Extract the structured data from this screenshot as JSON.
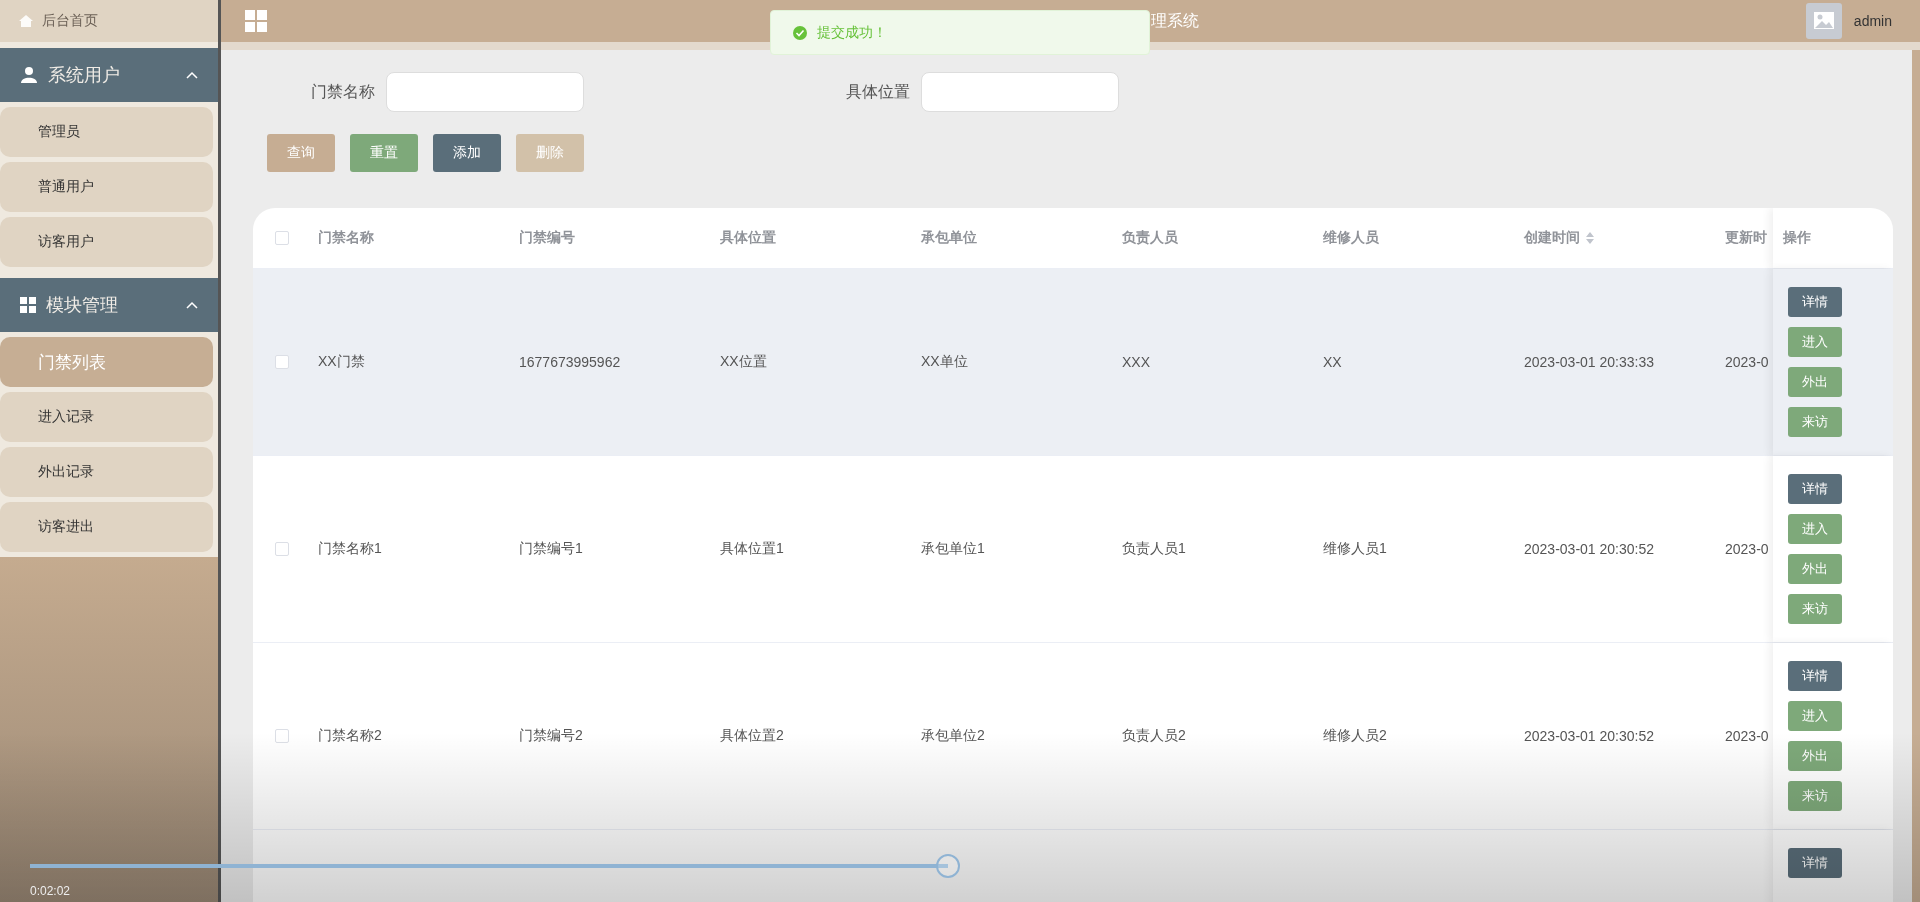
{
  "top_bar": {
    "title": "理系统",
    "user": "admin"
  },
  "toast": {
    "kind": "success",
    "message": "提交成功！"
  },
  "sidebar": {
    "home": "后台首页",
    "groups": [
      {
        "label": "系统用户",
        "expanded": true,
        "items": [
          {
            "label": "管理员",
            "selected": false
          },
          {
            "label": "普通用户",
            "selected": false
          },
          {
            "label": "访客用户",
            "selected": false
          }
        ]
      },
      {
        "label": "模块管理",
        "expanded": true,
        "items": [
          {
            "label": "门禁列表",
            "selected": true
          },
          {
            "label": "进入记录",
            "selected": false
          },
          {
            "label": "外出记录",
            "selected": false
          },
          {
            "label": "访客进出",
            "selected": false
          }
        ]
      }
    ]
  },
  "search": {
    "fields": [
      {
        "label": "门禁名称"
      },
      {
        "label": "具体位置"
      }
    ],
    "buttons": [
      {
        "label": "查询",
        "kind": "query",
        "disabled": false
      },
      {
        "label": "重置",
        "kind": "reset",
        "disabled": false
      },
      {
        "label": "添加",
        "kind": "add",
        "disabled": false
      },
      {
        "label": "删除",
        "kind": "delete",
        "disabled": true
      }
    ]
  },
  "table": {
    "columns": [
      {
        "label": "门禁名称"
      },
      {
        "label": "门禁编号"
      },
      {
        "label": "具体位置"
      },
      {
        "label": "承包单位"
      },
      {
        "label": "负责人员"
      },
      {
        "label": "维修人员"
      },
      {
        "label": "创建时间",
        "sortable": true
      },
      {
        "label": "更新时"
      }
    ],
    "actions_column": "操作",
    "all_checked": false,
    "rows": [
      {
        "highlighted": true,
        "checked": false,
        "cells": [
          "XX门禁",
          "1677673995962",
          "XX位置",
          "XX单位",
          "XXX",
          "XX",
          "2023-03-01 20:33:33",
          "2023-0"
        ],
        "actions": [
          {
            "label": "详情",
            "kind": "detail"
          },
          {
            "label": "进入",
            "kind": "action"
          },
          {
            "label": "外出",
            "kind": "action"
          },
          {
            "label": "来访",
            "kind": "action"
          }
        ]
      },
      {
        "highlighted": false,
        "checked": false,
        "cells": [
          "门禁名称1",
          "门禁编号1",
          "具体位置1",
          "承包单位1",
          "负责人员1",
          "维修人员1",
          "2023-03-01 20:30:52",
          "2023-0"
        ],
        "actions": [
          {
            "label": "详情",
            "kind": "detail"
          },
          {
            "label": "进入",
            "kind": "action"
          },
          {
            "label": "外出",
            "kind": "action"
          },
          {
            "label": "来访",
            "kind": "action"
          }
        ]
      },
      {
        "highlighted": false,
        "checked": false,
        "cells": [
          "门禁名称2",
          "门禁编号2",
          "具体位置2",
          "承包单位2",
          "负责人员2",
          "维修人员2",
          "2023-03-01 20:30:52",
          "2023-0"
        ],
        "actions": [
          {
            "label": "详情",
            "kind": "detail"
          },
          {
            "label": "进入",
            "kind": "action"
          },
          {
            "label": "外出",
            "kind": "action"
          },
          {
            "label": "来访",
            "kind": "action"
          }
        ]
      },
      {
        "cells": [],
        "actions": [
          {
            "label": "详情",
            "kind": "detail"
          }
        ]
      }
    ]
  },
  "video_player": {
    "time": "0:02:02",
    "level": 0.54
  }
}
